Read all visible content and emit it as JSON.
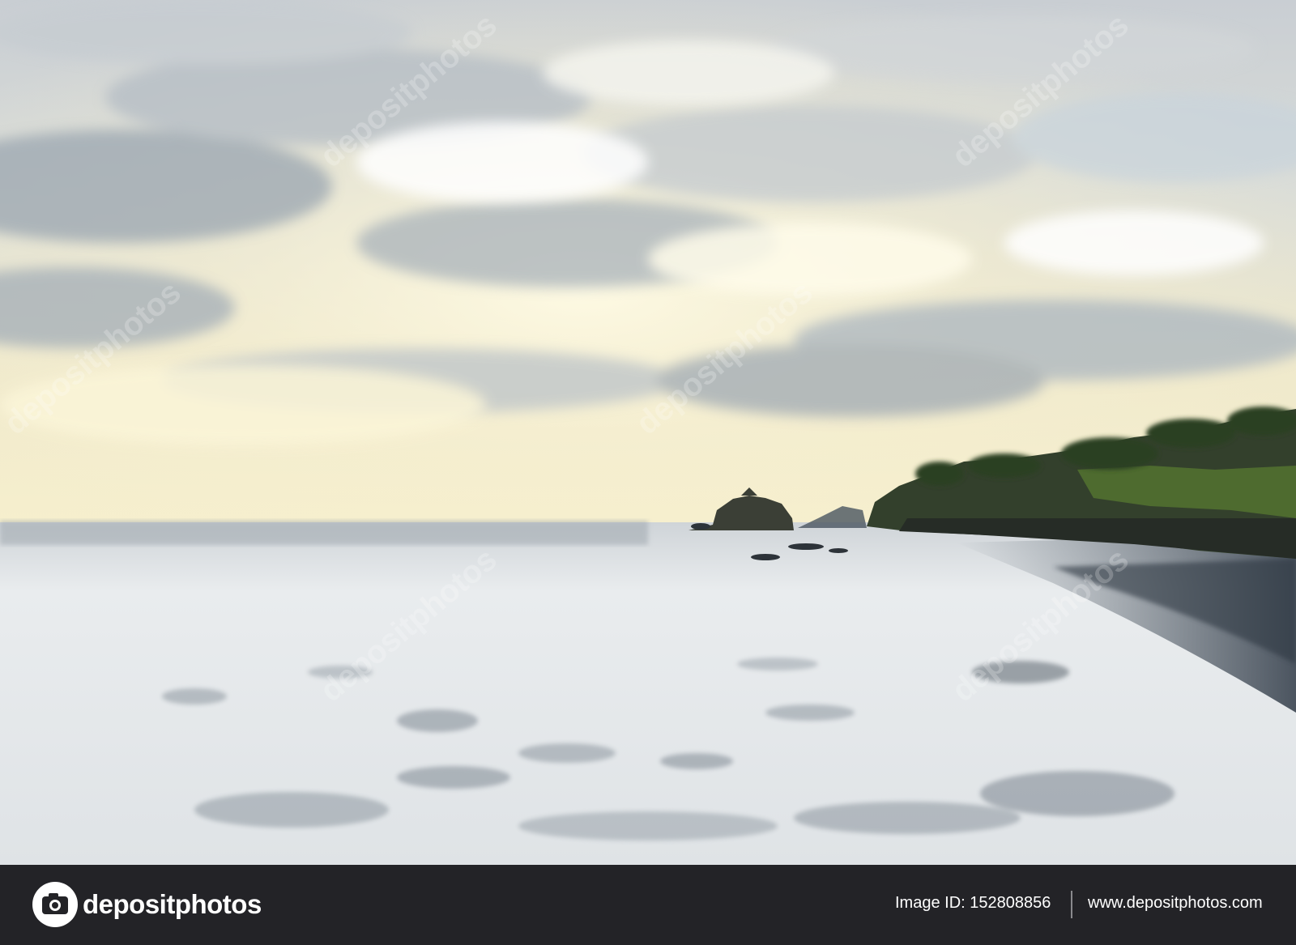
{
  "photo": {
    "subject": "ocean-coastline",
    "watermark_text": "depositphotos"
  },
  "footer": {
    "logo_text": "depositphotos",
    "image_id_label": "Image ID:",
    "image_id_value": "152808856",
    "site_url": "www.depositphotos.com",
    "background_color": "#232327"
  },
  "colors": {
    "sky_bright": "#f7f1cf",
    "sky_cloud": "#b9c2cc",
    "sea_foam": "#eef1f3",
    "sea_dark": "#3f4a55",
    "vegetation": "#2f4a24"
  }
}
